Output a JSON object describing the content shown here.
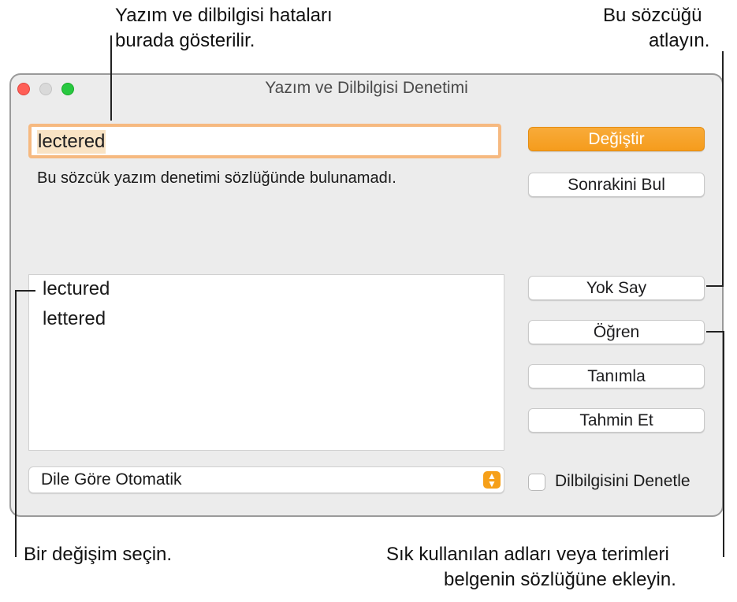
{
  "callouts": {
    "top_left_line1": "Yazım ve dilbilgisi hataları",
    "top_left_line2": "burada gösterilir.",
    "top_right_line1": "Bu sözcüğü",
    "top_right_line2": "atlayın.",
    "bottom_left": "Bir değişim seçin.",
    "bottom_right_line1": "Sık kullanılan adları veya terimleri",
    "bottom_right_line2": "belgenin sözlüğüne ekleyin."
  },
  "window": {
    "title": "Yazım ve Dilbilgisi Denetimi"
  },
  "misspelled_word": "lectered",
  "status_message": "Bu sözcük yazım denetimi sözlüğünde bulunamadı.",
  "buttons": {
    "change": "Değiştir",
    "find_next": "Sonrakini Bul",
    "ignore": "Yok Say",
    "learn": "Öğren",
    "define": "Tanımla",
    "guess": "Tahmin Et"
  },
  "suggestions": [
    "lectured",
    "lettered"
  ],
  "language_select": {
    "selected": "Dile Göre Otomatik"
  },
  "grammar_checkbox": {
    "label": "Dilbilgisini Denetle",
    "checked": false
  },
  "colors": {
    "accent": "#f59c1d",
    "focus_ring": "#f6b980"
  }
}
